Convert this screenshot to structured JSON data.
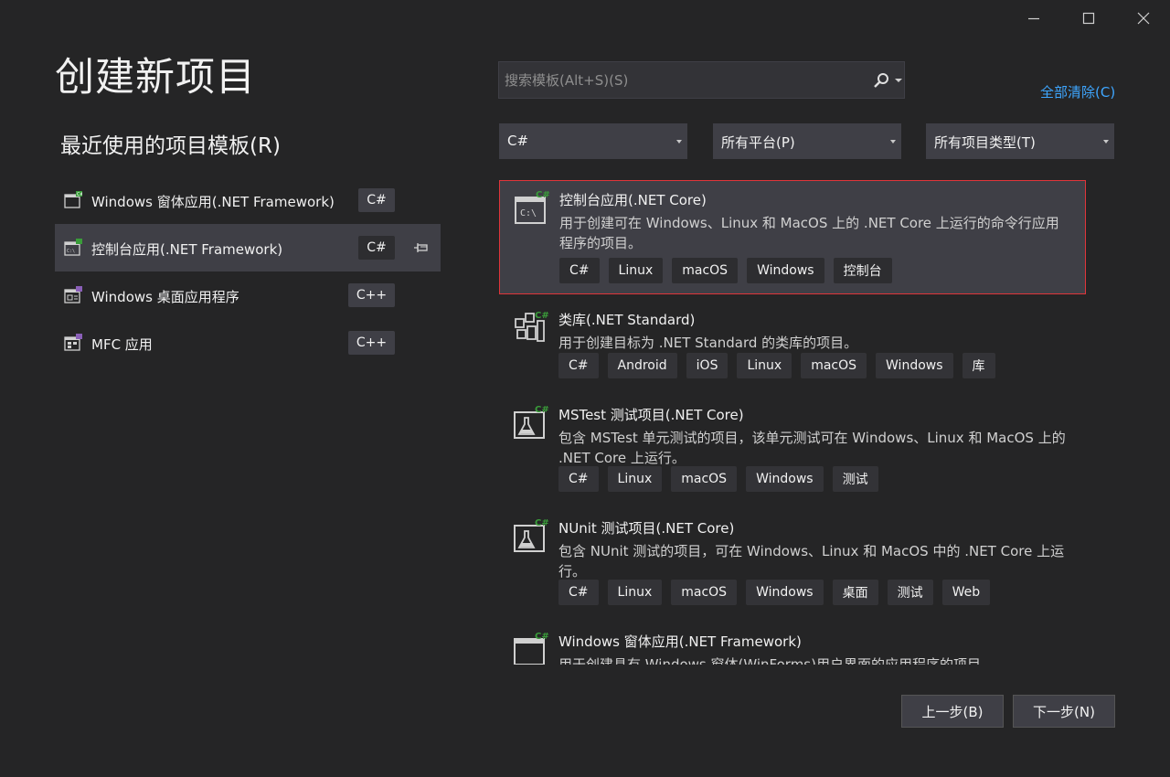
{
  "window": {
    "minimize_icon": "minimize-icon",
    "maximize_icon": "maximize-icon",
    "close_icon": "close-icon"
  },
  "page": {
    "title": "创建新项目"
  },
  "recent": {
    "title": "最近使用的项目模板(R)",
    "items": [
      {
        "name": "Windows 窗体应用(.NET Framework)",
        "lang": "C#",
        "icon": "winforms-icon",
        "selected": false
      },
      {
        "name": "控制台应用(.NET Framework)",
        "lang": "C#",
        "icon": "console-app-icon",
        "selected": true,
        "pin_icon": "pin-icon"
      },
      {
        "name": "Windows 桌面应用程序",
        "lang": "C++",
        "icon": "desktop-app-icon",
        "selected": false
      },
      {
        "name": "MFC 应用",
        "lang": "C++",
        "icon": "mfc-app-icon",
        "selected": false
      }
    ]
  },
  "search": {
    "placeholder": "搜索模板(Alt+S)(S)",
    "value": "",
    "icon": "search-icon"
  },
  "clear_all": "全部清除(C)",
  "filters": {
    "language": "C#",
    "platform": "所有平台(P)",
    "project_type": "所有项目类型(T)"
  },
  "templates": [
    {
      "name": "控制台应用(.NET Core)",
      "desc": "用于创建可在 Windows、Linux 和 MacOS 上的 .NET Core 上运行的命令行应用程序的项目。",
      "tags": [
        "C#",
        "Linux",
        "macOS",
        "Windows",
        "控制台"
      ],
      "icon": "console-app-icon",
      "selected": true
    },
    {
      "name": "类库(.NET Standard)",
      "desc": "用于创建目标为 .NET Standard 的类库的项目。",
      "tags": [
        "C#",
        "Android",
        "iOS",
        "Linux",
        "macOS",
        "Windows",
        "库"
      ],
      "icon": "class-library-icon",
      "selected": false
    },
    {
      "name": "MSTest 测试项目(.NET Core)",
      "desc": "包含 MSTest 单元测试的项目，该单元测试可在 Windows、Linux 和 MacOS 上的 .NET Core 上运行。",
      "tags": [
        "C#",
        "Linux",
        "macOS",
        "Windows",
        "测试"
      ],
      "icon": "test-project-icon",
      "selected": false
    },
    {
      "name": "NUnit 测试项目(.NET Core)",
      "desc": "包含 NUnit 测试的项目，可在 Windows、Linux 和 MacOS 中的 .NET Core 上运行。",
      "tags": [
        "C#",
        "Linux",
        "macOS",
        "Windows",
        "桌面",
        "测试",
        "Web"
      ],
      "icon": "test-project-icon",
      "selected": false
    },
    {
      "name": "Windows 窗体应用(.NET Framework)",
      "desc": "用于创建具有 Windows 窗体(WinForms)用户界面的应用程序的项目",
      "tags": [],
      "icon": "winforms-icon",
      "selected": false
    }
  ],
  "buttons": {
    "back": "上一步(B)",
    "next": "下一步(N)"
  },
  "colors": {
    "accent_link": "#3ea6ff",
    "selection_border": "#e0353a",
    "background": "#252526"
  }
}
